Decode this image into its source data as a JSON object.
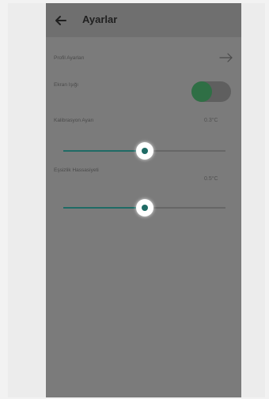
{
  "header": {
    "title": "Ayarlar",
    "back_icon": "back-arrow-icon"
  },
  "profile": {
    "label": "Profil Ayarları",
    "icon": "arrow-right-icon"
  },
  "toggle": {
    "label": "Ekran Işığı",
    "on": true,
    "color": "#2f6f45"
  },
  "sliders": [
    {
      "label": "Kalibrasyon Ayarı",
      "value_text": "0.3°C",
      "level": 0.5,
      "color": "#1f6b65"
    },
    {
      "label": "Eşsizlik Hassasiyeti",
      "value_text": "0.5°C",
      "level": 0.5,
      "color": "#1f6b65"
    }
  ]
}
